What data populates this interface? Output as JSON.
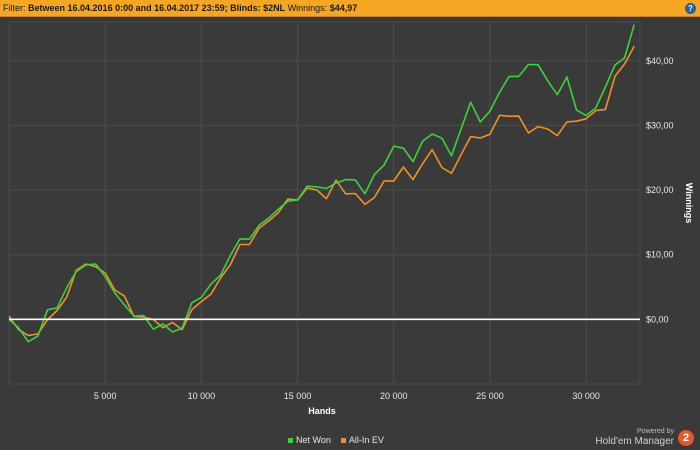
{
  "filter_bar": {
    "prefix": "Filter: ",
    "filter_text": "Between 16.04.2016 0:00 and 16.04.2017 23:59; Blinds: $2NL",
    "winnings_label": "Winnings:",
    "winnings_value": "$44,97",
    "help_label": "?"
  },
  "chart_data": {
    "type": "line",
    "title": "",
    "xlabel": "Hands",
    "ylabel": "Winnings",
    "xlim": [
      0,
      32800
    ],
    "ylim": [
      -10,
      46
    ],
    "x_ticks": [
      {
        "v": 5000,
        "label": "5 000"
      },
      {
        "v": 10000,
        "label": "10 000"
      },
      {
        "v": 15000,
        "label": "15 000"
      },
      {
        "v": 20000,
        "label": "20 000"
      },
      {
        "v": 25000,
        "label": "25 000"
      },
      {
        "v": 30000,
        "label": "30 000"
      }
    ],
    "y_ticks": [
      {
        "v": 0,
        "label": "$0,00"
      },
      {
        "v": 10,
        "label": "$10,00"
      },
      {
        "v": 20,
        "label": "$20,00"
      },
      {
        "v": 30,
        "label": "$30,00"
      },
      {
        "v": 40,
        "label": "$40,00"
      }
    ],
    "grid": true,
    "zero_line": true,
    "legend_position": "bottom",
    "series": [
      {
        "name": "Net Won",
        "color": "#3cd23c",
        "x": [
          0,
          500,
          1000,
          1500,
          2000,
          2500,
          3000,
          3500,
          4000,
          4500,
          5000,
          5500,
          6000,
          6500,
          7000,
          7500,
          8000,
          8500,
          9000,
          9500,
          10000,
          10500,
          11000,
          11500,
          12000,
          12500,
          13000,
          13500,
          14000,
          14500,
          15000,
          15500,
          16000,
          16500,
          17000,
          17500,
          18000,
          18500,
          19000,
          19500,
          20000,
          20500,
          21000,
          21500,
          22000,
          22500,
          23000,
          23500,
          24000,
          24500,
          25000,
          25500,
          26000,
          26500,
          27000,
          27500,
          28000,
          28500,
          29000,
          29500,
          30000,
          30500,
          31000,
          31500,
          32000,
          32500
        ],
        "values": [
          0,
          -1,
          -4,
          -2,
          1,
          2,
          5,
          7,
          9,
          8,
          7,
          4,
          2,
          1,
          0,
          -1,
          -1,
          -2,
          -1,
          2,
          4,
          5,
          7,
          10,
          12,
          13,
          14,
          16,
          17,
          18,
          19,
          20,
          21,
          20,
          21,
          22,
          21,
          20,
          22,
          24,
          27,
          26,
          25,
          27,
          29,
          28,
          25,
          30,
          33,
          31,
          32,
          35,
          38,
          37,
          40,
          39,
          37,
          35,
          37,
          33,
          31,
          33,
          36,
          39,
          41,
          45
        ]
      },
      {
        "name": "All-In EV",
        "color": "#f0902a",
        "x": [
          0,
          500,
          1000,
          1500,
          2000,
          2500,
          3000,
          3500,
          4000,
          4500,
          5000,
          5500,
          6000,
          6500,
          7000,
          7500,
          8000,
          8500,
          9000,
          9500,
          10000,
          10500,
          11000,
          11500,
          12000,
          12500,
          13000,
          13500,
          14000,
          14500,
          15000,
          15500,
          16000,
          16500,
          17000,
          17500,
          18000,
          18500,
          19000,
          19500,
          20000,
          20500,
          21000,
          21500,
          22000,
          22500,
          23000,
          23500,
          24000,
          24500,
          25000,
          25500,
          26000,
          26500,
          27000,
          27500,
          28000,
          28500,
          29000,
          29500,
          30000,
          30500,
          31000,
          31500,
          32000,
          32500
        ],
        "values": [
          0,
          -1,
          -3,
          -2,
          0,
          1,
          4,
          7,
          9,
          8,
          7,
          5,
          3,
          1,
          0,
          0,
          -1,
          -1,
          -1,
          1,
          3,
          4,
          6,
          9,
          11,
          12,
          14,
          15,
          17,
          18,
          19,
          20,
          20,
          19,
          21,
          20,
          19,
          18,
          19,
          21,
          22,
          23,
          22,
          24,
          26,
          24,
          22,
          26,
          28,
          28,
          29,
          31,
          32,
          31,
          29,
          30,
          29,
          29,
          30,
          31,
          31,
          32,
          33,
          37,
          40,
          42
        ]
      }
    ]
  },
  "legend": {
    "items": [
      {
        "label": "Net Won",
        "color": "#3cd23c"
      },
      {
        "label": "All-In EV",
        "color": "#f0902a"
      }
    ]
  },
  "branding": {
    "powered_by": "Powered by",
    "product": "Hold'em Manager",
    "logo_text": "2"
  }
}
